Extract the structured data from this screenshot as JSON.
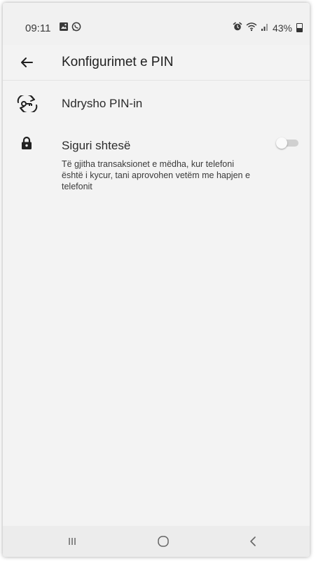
{
  "status_bar": {
    "time": "09:11",
    "battery": "43%"
  },
  "app_bar": {
    "title": "Konfigurimet e PIN"
  },
  "settings": {
    "change_pin": {
      "label": "Ndrysho PIN-in",
      "icon": "key-rotate-icon"
    },
    "extra_security": {
      "label": "Siguri shtesë",
      "description": "Të gjitha transaksionet e mëdha, kur telefoni është i kycur, tani aprovohen vetëm me hapjen e telefonit",
      "icon": "lock-icon",
      "enabled": false
    }
  },
  "nav_bar": {
    "icons": [
      "recents-icon",
      "home-icon",
      "back-icon"
    ]
  },
  "colors": {
    "background": "#f3f3f3",
    "text": "#1f1f1f",
    "toggle_off": "#d0d0d0"
  }
}
